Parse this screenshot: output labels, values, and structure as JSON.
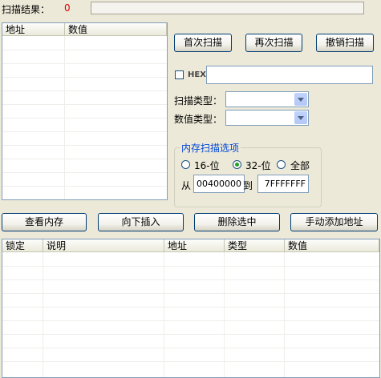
{
  "scan": {
    "result_label": "扫描结果：",
    "result_count": "0",
    "progress": 0
  },
  "results_list": {
    "columns": [
      "地址",
      "数值"
    ],
    "rows": []
  },
  "buttons": {
    "first_scan": "首次扫描",
    "next_scan": "再次扫描",
    "undo_scan": "撤销扫描",
    "view_memory": "查看内存",
    "insert_down": "向下插入",
    "delete_selected": "删除选中",
    "add_address_manually": "手动添加地址"
  },
  "hex": {
    "label": "HEX",
    "checked": false,
    "value": ""
  },
  "scan_type": {
    "label": "扫描类型：",
    "selected": ""
  },
  "value_type": {
    "label": "数值类型：",
    "selected": ""
  },
  "memory_options": {
    "title": "内存扫描选项",
    "radio_16": "16-位",
    "radio_32": "32-位",
    "radio_all": "全部",
    "selected": "32-位",
    "from_label": "从",
    "from_value": "00400000",
    "to_label": "到",
    "to_value": "7FFFFFFF"
  },
  "address_list": {
    "columns": [
      "锁定",
      "说明",
      "地址",
      "类型",
      "数值"
    ],
    "rows": []
  }
}
